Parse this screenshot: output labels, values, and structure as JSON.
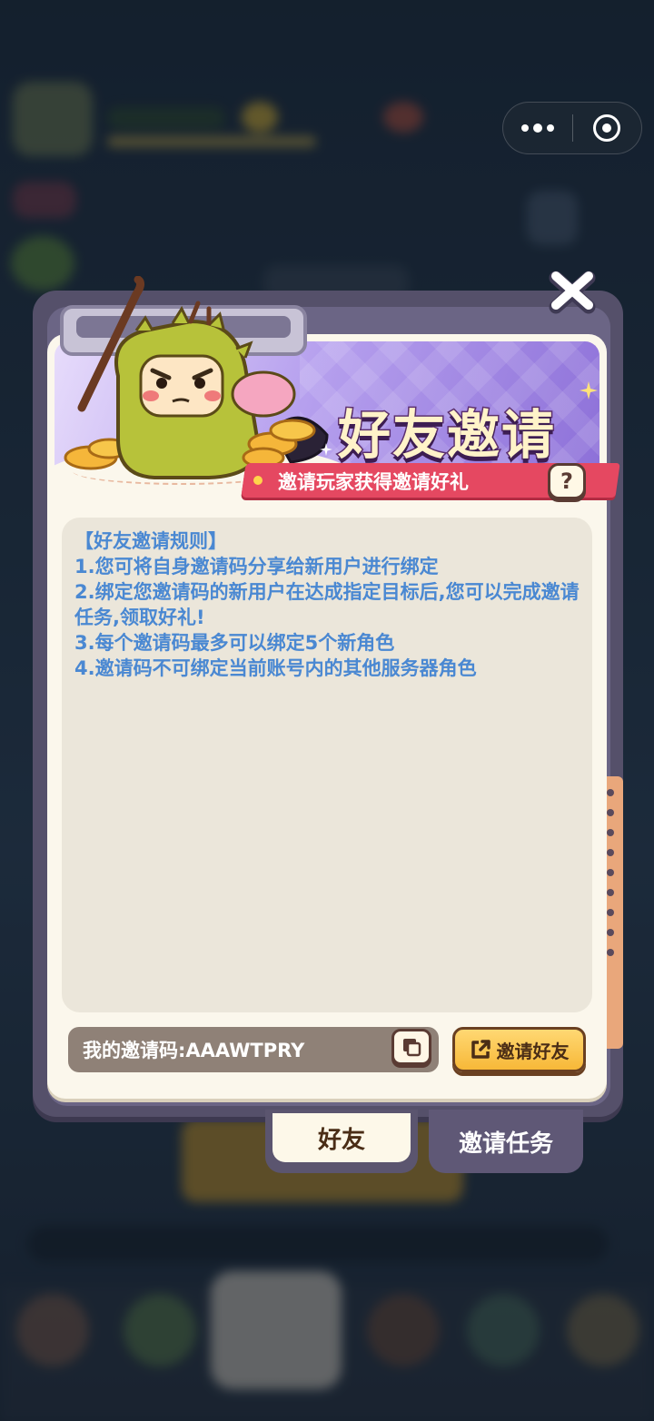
{
  "capsule": {
    "more_icon": "more-dots-icon",
    "close_icon": "target-circle-icon"
  },
  "dialog": {
    "title": "好友邀请",
    "subtitle": "邀请玩家获得邀请好礼",
    "help_label": "?",
    "rules": [
      "【好友邀请规则】",
      "1.您可将自身邀请码分享给新用户进行绑定",
      "2.绑定您邀请码的新用户在达成指定目标后,您可以完成邀请任务,领取好礼!",
      "3.每个邀请码最多可以绑定5个新角色",
      "4.邀请码不可绑定当前账号内的其他服务器角色"
    ],
    "code_text": "我的邀请码:AAAWTPRY",
    "invite_button": "邀请好友"
  },
  "tabs": [
    {
      "label": "好友",
      "active": true
    },
    {
      "label": "邀请任务",
      "active": false
    }
  ],
  "colors": {
    "rules_text": "#4a88d2",
    "subtitle_bar": "#e54861",
    "invite_button": "#f7b838",
    "board": "#55506a"
  }
}
